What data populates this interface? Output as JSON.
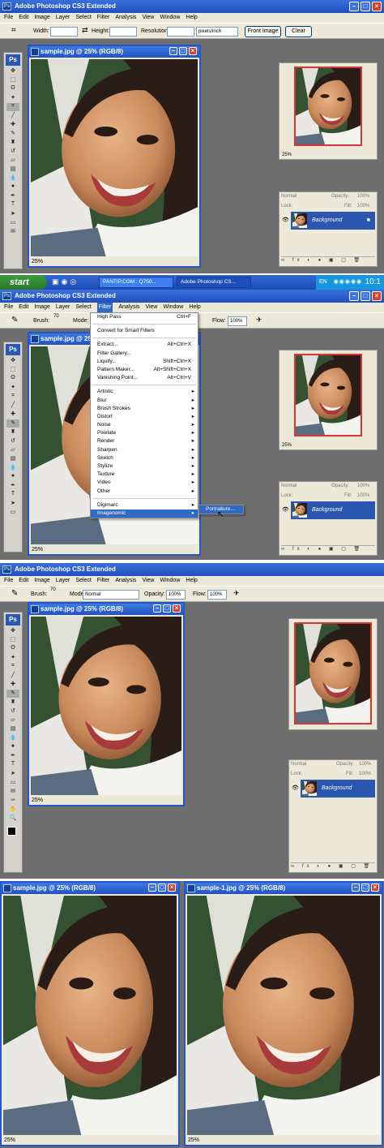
{
  "panel1": {
    "app_title": "Adobe Photoshop CS3 Extended",
    "menu": [
      "File",
      "Edit",
      "Image",
      "Layer",
      "Select",
      "Filter",
      "Analysis",
      "View",
      "Window",
      "Help"
    ],
    "options": {
      "width_label": "Width:",
      "height_label": "Height:",
      "resolution_label": "Resolution:",
      "resolution_unit": "pixels/inch",
      "front_image_button": "Front Image",
      "clear_button": "Clear"
    },
    "doc_title": "sample.jpg @ 25% (RGB/8)",
    "doc_zoom": "25%",
    "nav_zoom": "25%",
    "layers": {
      "blend_mode": "Normal",
      "opacity_label": "Opacity:",
      "opacity_value": "100%",
      "lock_label": "Lock:",
      "fill_label": "Fill:",
      "fill_value": "100%",
      "layer_name": "Background"
    }
  },
  "taskbar": {
    "start_label": "start",
    "items": [
      "PANTIP.COM : Q750...",
      "Adobe Photoshop CS..."
    ],
    "tray_lang": "EN",
    "tray_time": "10:1"
  },
  "panel2": {
    "app_title": "Adobe Photoshop CS3 Extended",
    "menu": [
      "File",
      "Edit",
      "Image",
      "Layer",
      "Select",
      "Filter",
      "Analysis",
      "View",
      "Window",
      "Help"
    ],
    "options": {
      "brush_label": "Brush:",
      "brush_size": "70",
      "mode_label": "Mode:",
      "flow_label": "Flow:",
      "flow_value": "100%"
    },
    "doc_title": "sample.jpg @ 25",
    "doc_zoom": "25%",
    "nav_zoom": "25%",
    "filter_menu": [
      {
        "label": "High Pass",
        "shortcut": "Ctrl+F"
      },
      {
        "sep": true
      },
      {
        "label": "Convert for Smart Filters"
      },
      {
        "sep": true
      },
      {
        "label": "Extract...",
        "shortcut": "Alt+Ctrl+X"
      },
      {
        "label": "Filter Gallery..."
      },
      {
        "label": "Liquify...",
        "shortcut": "Shift+Ctrl+X"
      },
      {
        "label": "Pattern Maker...",
        "shortcut": "Alt+Shift+Ctrl+X"
      },
      {
        "label": "Vanishing Point...",
        "shortcut": "Alt+Ctrl+V"
      },
      {
        "sep": true
      },
      {
        "label": "Artistic",
        "sub": true
      },
      {
        "label": "Blur",
        "sub": true
      },
      {
        "label": "Brush Strokes",
        "sub": true
      },
      {
        "label": "Distort",
        "sub": true
      },
      {
        "label": "Noise",
        "sub": true
      },
      {
        "label": "Pixelate",
        "sub": true
      },
      {
        "label": "Render",
        "sub": true
      },
      {
        "label": "Sharpen",
        "sub": true
      },
      {
        "label": "Sketch",
        "sub": true
      },
      {
        "label": "Stylize",
        "sub": true
      },
      {
        "label": "Texture",
        "sub": true
      },
      {
        "label": "Video",
        "sub": true
      },
      {
        "label": "Other",
        "sub": true
      },
      {
        "sep": true
      },
      {
        "label": "Digimarc",
        "sub": true
      },
      {
        "label": "Imagenomic",
        "sub": true,
        "highlight": true
      }
    ],
    "submenu_item": "Portraiture...",
    "layers": {
      "blend_mode": "Normal",
      "opacity_label": "Opacity:",
      "opacity_value": "100%",
      "lock_label": "Lock:",
      "fill_label": "Fill:",
      "fill_value": "100%",
      "layer_name": "Background"
    }
  },
  "panel3": {
    "app_title": "Adobe Photoshop CS3 Extended",
    "menu": [
      "File",
      "Edit",
      "Image",
      "Layer",
      "Select",
      "Filter",
      "Analysis",
      "View",
      "Window",
      "Help"
    ],
    "options": {
      "brush_label": "Brush:",
      "brush_size": "70",
      "mode_label": "Mode:",
      "mode_value": "Normal",
      "opacity_label": "Opacity:",
      "opacity_value": "100%",
      "flow_label": "Flow:",
      "flow_value": "100%"
    },
    "doc_title": "sample.jpg @ 25% (RGB/8)",
    "doc_zoom": "25%",
    "layers": {
      "blend_mode": "Normal",
      "opacity_label": "Opacity:",
      "opacity_value": "100%",
      "lock_label": "Lock:",
      "fill_label": "Fill:",
      "fill_value": "100%",
      "layer_name": "Background"
    }
  },
  "panel4": {
    "left_title": "sample.jpg @ 25% (RGB/8)",
    "right_title": "sample-1.jpg @ 25% (RGB/8)",
    "left_zoom": "25%",
    "right_zoom": "25%"
  },
  "colors": {
    "title_blue": "#2556c9",
    "menu_bg": "#ece9d8",
    "workspace": "#6e6e6e",
    "highlight": "#316ac5"
  }
}
